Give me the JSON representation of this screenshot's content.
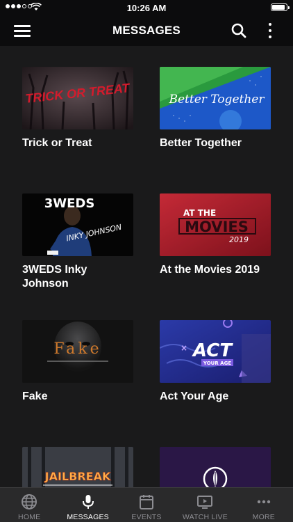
{
  "status_bar": {
    "time": "10:26 AM",
    "battery_level": 0.9
  },
  "header": {
    "title": "MESSAGES"
  },
  "messages": [
    {
      "title": "Trick or Treat",
      "thumb_text": "TRICK OR TREAT"
    },
    {
      "title": "Better Together",
      "thumb_text": "Better Together"
    },
    {
      "title": "3WEDS Inky Johnson",
      "thumb_text": "3WEDS",
      "thumb_text2": "INKY JOHNSON"
    },
    {
      "title": "At the Movies 2019",
      "thumb_text": "AT THE",
      "thumb_text2": "MOVIES",
      "thumb_text3": "2019"
    },
    {
      "title": "Fake",
      "thumb_text": "Fake"
    },
    {
      "title": "Act Your Age",
      "thumb_text": "ACT",
      "thumb_text2": "YOUR AGE"
    },
    {
      "title": "",
      "thumb_text": "JAILBREAK"
    },
    {
      "title": "",
      "thumb_text": ""
    }
  ],
  "tabs": [
    {
      "label": "HOME",
      "icon": "globe-icon",
      "active": false
    },
    {
      "label": "MESSAGES",
      "icon": "microphone-icon",
      "active": true
    },
    {
      "label": "EVENTS",
      "icon": "calendar-icon",
      "active": false
    },
    {
      "label": "WATCH LIVE",
      "icon": "tv-play-icon",
      "active": false
    },
    {
      "label": "MORE",
      "icon": "more-dots-icon",
      "active": false
    }
  ],
  "colors": {
    "background": "#1a1a1b",
    "bar": "#0c0c0d",
    "tabbar": "#2a2a2b",
    "tab_inactive": "#8d8d92"
  }
}
